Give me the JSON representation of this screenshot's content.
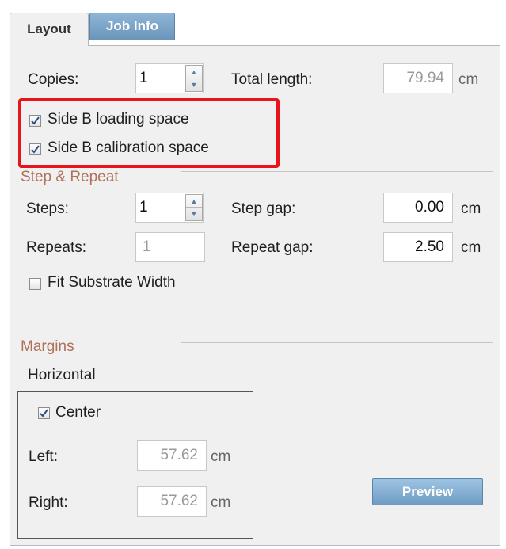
{
  "tabs": [
    {
      "label": "Layout",
      "active": true
    },
    {
      "label": "Job Info",
      "active": false
    }
  ],
  "copies": {
    "label": "Copies:",
    "value": "1"
  },
  "total_length": {
    "label": "Total length:",
    "value": "79.94",
    "unit": "cm"
  },
  "side_b_loading": {
    "label": "Side B loading space",
    "checked": true
  },
  "side_b_calibration": {
    "label": "Side B calibration space",
    "checked": true
  },
  "step_repeat": {
    "title": "Step & Repeat",
    "steps": {
      "label": "Steps:",
      "value": "1"
    },
    "step_gap": {
      "label": "Step gap:",
      "value": "0.00",
      "unit": "cm"
    },
    "repeats": {
      "label": "Repeats:",
      "value": "1"
    },
    "repeat_gap": {
      "label": "Repeat gap:",
      "value": "2.50",
      "unit": "cm"
    },
    "fit_substrate": {
      "label": "Fit Substrate Width",
      "checked": false
    }
  },
  "margins": {
    "title": "Margins",
    "horizontal": {
      "title": "Horizontal",
      "center": {
        "label": "Center",
        "checked": true
      },
      "left": {
        "label": "Left:",
        "value": "57.62",
        "unit": "cm"
      },
      "right": {
        "label": "Right:",
        "value": "57.62",
        "unit": "cm"
      }
    }
  },
  "preview_button": {
    "label": "Preview"
  },
  "colors": {
    "section_title": "#b0705a",
    "highlight": "#e8141c",
    "tab_active_bg": "#f0f0f0",
    "tab_inactive_bg": "#7fa7ca",
    "button_bg": "#84addb"
  },
  "icons": {
    "checkmark": "checkmark-icon",
    "spinner_up": "spinner-up-icon",
    "spinner_down": "spinner-down-icon"
  }
}
